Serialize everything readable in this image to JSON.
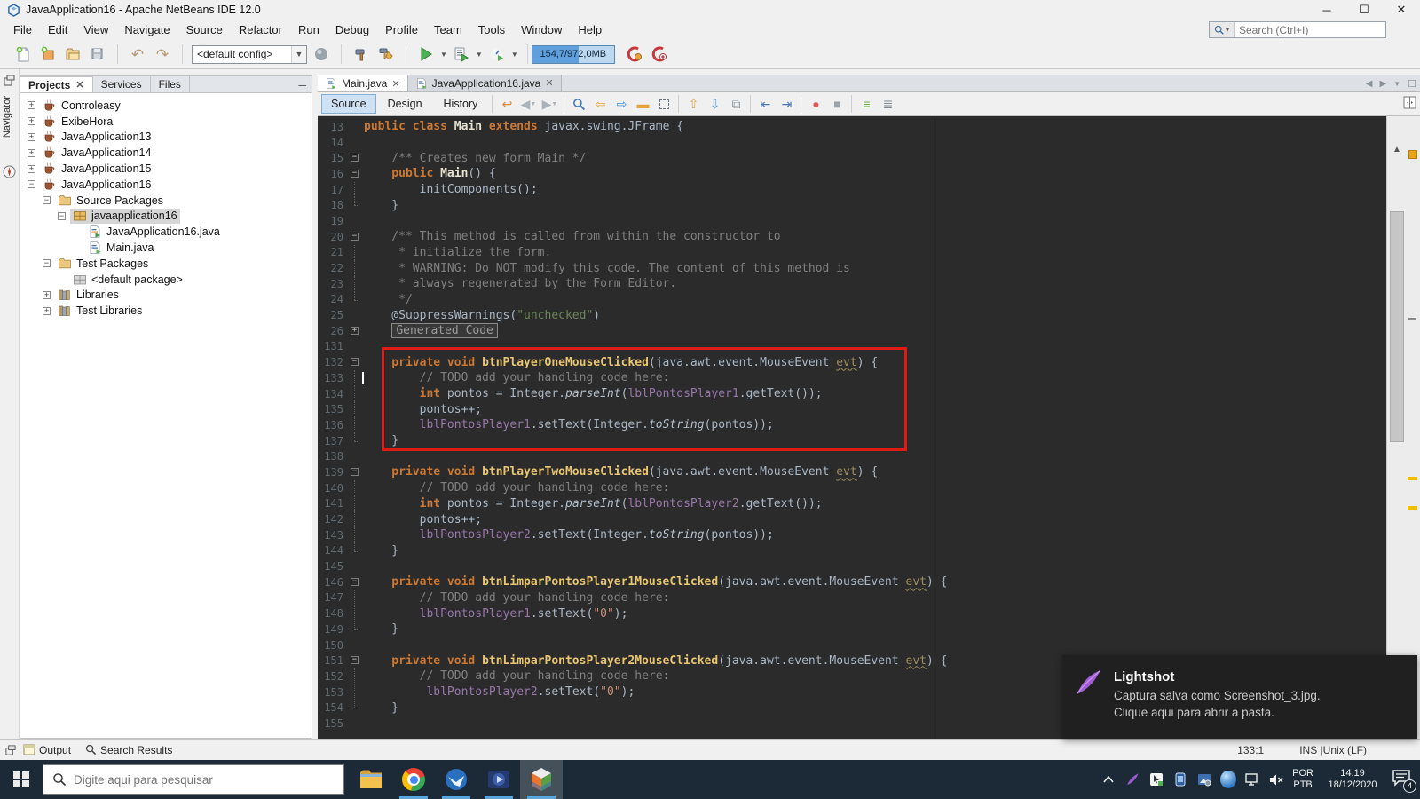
{
  "colors": {
    "red": "#dd1d15",
    "memfill": "#5fa0dc",
    "accent_run": "#3fae46",
    "kw": "#cc7832",
    "field": "#9876aa"
  },
  "window": {
    "title": "JavaApplication16 - Apache NetBeans IDE 12.0"
  },
  "menu": [
    "File",
    "Edit",
    "View",
    "Navigate",
    "Source",
    "Refactor",
    "Run",
    "Debug",
    "Profile",
    "Team",
    "Tools",
    "Window",
    "Help"
  ],
  "search": {
    "placeholder": "Search (Ctrl+I)"
  },
  "toolbar": {
    "config": "<default config>",
    "memory": "154,7/972,0MB"
  },
  "left_rail": {
    "navigator": "Navigator"
  },
  "projects": {
    "tabs": [
      {
        "label": "Projects",
        "active": true,
        "closable": true
      },
      {
        "label": "Services",
        "active": false
      },
      {
        "label": "Files",
        "active": false
      }
    ],
    "tree": [
      {
        "label": "Controleasy",
        "indent": 0,
        "e": "+",
        "icon": "cup",
        "sel": false
      },
      {
        "label": "ExibeHora",
        "indent": 0,
        "e": "+",
        "icon": "cup",
        "sel": false
      },
      {
        "label": "JavaApplication13",
        "indent": 0,
        "e": "+",
        "icon": "cup",
        "sel": false
      },
      {
        "label": "JavaApplication14",
        "indent": 0,
        "e": "+",
        "icon": "cup",
        "sel": false
      },
      {
        "label": "JavaApplication15",
        "indent": 0,
        "e": "+",
        "icon": "cup",
        "sel": false
      },
      {
        "label": "JavaApplication16",
        "indent": 0,
        "e": "-",
        "icon": "cup",
        "sel": false
      },
      {
        "label": "Source Packages",
        "indent": 1,
        "e": "-",
        "icon": "folder",
        "sel": false
      },
      {
        "label": "javaapplication16",
        "indent": 2,
        "e": "-",
        "icon": "pkg",
        "sel": true
      },
      {
        "label": "JavaApplication16.java",
        "indent": 3,
        "e": "",
        "icon": "jmain",
        "sel": false
      },
      {
        "label": "Main.java",
        "indent": 3,
        "e": "",
        "icon": "jfile",
        "sel": false
      },
      {
        "label": "Test Packages",
        "indent": 1,
        "e": "-",
        "icon": "folder",
        "sel": false
      },
      {
        "label": "<default package>",
        "indent": 2,
        "e": "",
        "icon": "pkgg",
        "sel": false
      },
      {
        "label": "Libraries",
        "indent": 1,
        "e": "+",
        "icon": "lib",
        "sel": false
      },
      {
        "label": "Test Libraries",
        "indent": 1,
        "e": "+",
        "icon": "lib",
        "sel": false
      }
    ]
  },
  "editor": {
    "tabs": [
      {
        "label": "Main.java",
        "active": true
      },
      {
        "label": "JavaApplication16.java",
        "active": false
      }
    ],
    "views": [
      {
        "label": "Source",
        "sel": true
      },
      {
        "label": "Design",
        "sel": false
      },
      {
        "label": "History",
        "sel": false
      }
    ],
    "code": [
      {
        "n": "13",
        "s": [
          [
            "kw",
            "public class "
          ],
          [
            "cls",
            "Main "
          ],
          [
            "kw",
            "extends"
          ],
          [
            "pl",
            " javax.swing.JFrame {"
          ]
        ]
      },
      {
        "n": "14",
        "s": []
      },
      {
        "n": "15",
        "f": "-",
        "s": [
          [
            "com",
            "    /** Creates new form Main */"
          ]
        ]
      },
      {
        "n": "16",
        "f": "-",
        "s": [
          [
            "kw",
            "    public "
          ],
          [
            "cls",
            "Main"
          ],
          [
            "pl",
            "() {"
          ]
        ]
      },
      {
        "n": "17",
        "g": "|",
        "s": [
          [
            "pl",
            "        initComponents();"
          ]
        ]
      },
      {
        "n": "18",
        "g": "L",
        "s": [
          [
            "pl",
            "    }"
          ]
        ]
      },
      {
        "n": "19",
        "s": []
      },
      {
        "n": "20",
        "f": "-",
        "s": [
          [
            "com",
            "    /** This method is called from within the constructor to"
          ]
        ]
      },
      {
        "n": "21",
        "g": "|",
        "s": [
          [
            "com",
            "     * initialize the form."
          ]
        ]
      },
      {
        "n": "22",
        "g": "|",
        "s": [
          [
            "com",
            "     * WARNING: Do NOT modify this code. The content of this method is"
          ]
        ]
      },
      {
        "n": "23",
        "g": "|",
        "s": [
          [
            "com",
            "     * always regenerated by the Form Editor."
          ]
        ]
      },
      {
        "n": "24",
        "g": "L",
        "s": [
          [
            "com",
            "     */"
          ]
        ]
      },
      {
        "n": "25",
        "s": [
          [
            "pl",
            "    @SuppressWarnings("
          ],
          [
            "strg",
            "\"unchecked\""
          ],
          [
            "pl",
            ")"
          ]
        ]
      },
      {
        "n": "26",
        "f": "+",
        "box": "Generated Code",
        "s": []
      },
      {
        "n": "131",
        "s": []
      },
      {
        "n": "132",
        "f": "-",
        "s": [
          [
            "kw",
            "    private void "
          ],
          [
            "def",
            "btnPlayerOneMouseClicked"
          ],
          [
            "pl",
            "(java.awt.event.MouseEvent "
          ],
          [
            "evt",
            "evt"
          ],
          [
            "pl",
            ") {"
          ]
        ]
      },
      {
        "n": "133",
        "g": "|",
        "caret": true,
        "s": [
          [
            "com",
            "        // TODO add your handling code here:"
          ]
        ]
      },
      {
        "n": "134",
        "g": "|",
        "s": [
          [
            "pl",
            "        "
          ],
          [
            "kw",
            "int"
          ],
          [
            "pl",
            " pontos = Integer."
          ],
          [
            "its",
            "parseInt"
          ],
          [
            "pl",
            "("
          ],
          [
            "fld",
            "lblPontosPlayer1"
          ],
          [
            "pl",
            ".getText());"
          ]
        ]
      },
      {
        "n": "135",
        "g": "|",
        "s": [
          [
            "pl",
            "        pontos++;"
          ]
        ]
      },
      {
        "n": "136",
        "g": "|",
        "s": [
          [
            "pl",
            "        "
          ],
          [
            "fld",
            "lblPontosPlayer1"
          ],
          [
            "pl",
            ".setText(Integer."
          ],
          [
            "its",
            "toString"
          ],
          [
            "pl",
            "(pontos));"
          ]
        ]
      },
      {
        "n": "137",
        "g": "L",
        "s": [
          [
            "pl",
            "    }"
          ]
        ]
      },
      {
        "n": "138",
        "s": []
      },
      {
        "n": "139",
        "f": "-",
        "s": [
          [
            "kw",
            "    private void "
          ],
          [
            "def",
            "btnPlayerTwoMouseClicked"
          ],
          [
            "pl",
            "(java.awt.event.MouseEvent "
          ],
          [
            "evt",
            "evt"
          ],
          [
            "pl",
            ") {"
          ]
        ]
      },
      {
        "n": "140",
        "g": "|",
        "s": [
          [
            "com",
            "        // TODO add your handling code here:"
          ]
        ]
      },
      {
        "n": "141",
        "g": "|",
        "s": [
          [
            "pl",
            "        "
          ],
          [
            "kw",
            "int"
          ],
          [
            "pl",
            " pontos = Integer."
          ],
          [
            "its",
            "parseInt"
          ],
          [
            "pl",
            "("
          ],
          [
            "fld",
            "lblPontosPlayer2"
          ],
          [
            "pl",
            ".getText());"
          ]
        ]
      },
      {
        "n": "142",
        "g": "|",
        "s": [
          [
            "pl",
            "        pontos++;"
          ]
        ]
      },
      {
        "n": "143",
        "g": "|",
        "s": [
          [
            "pl",
            "        "
          ],
          [
            "fld",
            "lblPontosPlayer2"
          ],
          [
            "pl",
            ".setText(Integer."
          ],
          [
            "its",
            "toString"
          ],
          [
            "pl",
            "(pontos));"
          ]
        ]
      },
      {
        "n": "144",
        "g": "L",
        "s": [
          [
            "pl",
            "    }"
          ]
        ]
      },
      {
        "n": "145",
        "s": []
      },
      {
        "n": "146",
        "f": "-",
        "s": [
          [
            "kw",
            "    private void "
          ],
          [
            "def",
            "btnLimparPontosPlayer1MouseClicked"
          ],
          [
            "pl",
            "(java.awt.event.MouseEvent "
          ],
          [
            "evt",
            "evt"
          ],
          [
            "pl",
            ") {"
          ]
        ]
      },
      {
        "n": "147",
        "g": "|",
        "s": [
          [
            "com",
            "        // TODO add your handling code here:"
          ]
        ]
      },
      {
        "n": "148",
        "g": "|",
        "s": [
          [
            "pl",
            "        "
          ],
          [
            "fld",
            "lblPontosPlayer1"
          ],
          [
            "pl",
            ".setText("
          ],
          [
            "stro",
            "\"0\""
          ],
          [
            "pl",
            ");"
          ]
        ]
      },
      {
        "n": "149",
        "g": "L",
        "s": [
          [
            "pl",
            "    }"
          ]
        ]
      },
      {
        "n": "150",
        "s": []
      },
      {
        "n": "151",
        "f": "-",
        "s": [
          [
            "kw",
            "    private void "
          ],
          [
            "def",
            "btnLimparPontosPlayer2MouseClicked"
          ],
          [
            "pl",
            "(java.awt.event.MouseEvent "
          ],
          [
            "evt",
            "evt"
          ],
          [
            "pl",
            ") {"
          ]
        ]
      },
      {
        "n": "152",
        "g": "|",
        "s": [
          [
            "com",
            "        // TODO add your handling code here:"
          ]
        ]
      },
      {
        "n": "153",
        "g": "|",
        "s": [
          [
            "pl",
            "         "
          ],
          [
            "fld",
            "lblPontosPlayer2"
          ],
          [
            "pl",
            ".setText("
          ],
          [
            "stro",
            "\"0\""
          ],
          [
            "pl",
            ");"
          ]
        ]
      },
      {
        "n": "154",
        "g": "L",
        "s": [
          [
            "pl",
            "    }"
          ]
        ]
      },
      {
        "n": "155",
        "s": []
      }
    ]
  },
  "bottom_bar": {
    "output": "Output",
    "search_results": "Search Results",
    "caret_pos": "133:1",
    "mode": "INS |Unix (LF)"
  },
  "notification": {
    "app": "Lightshot",
    "line1": "Captura salva como Screenshot_3.jpg.",
    "line2": "Clique aqui para abrir a pasta."
  },
  "taskbar": {
    "search_placeholder": "Digite aqui para pesquisar",
    "lang_top": "POR",
    "lang_bottom": "PTB",
    "time": "14:19",
    "date": "18/12/2020",
    "notif_count": "4"
  }
}
